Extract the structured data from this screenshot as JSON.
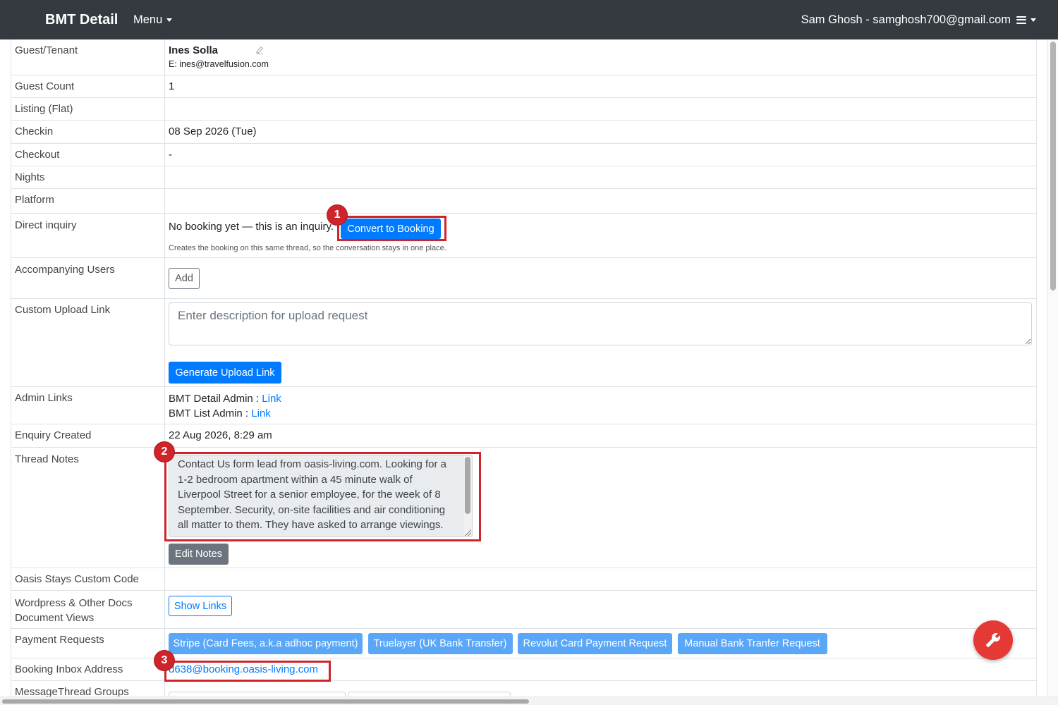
{
  "navbar": {
    "brand": "BMT Detail",
    "menu_label": "Menu",
    "user_label": "Sam Ghosh - samghosh700@gmail.com"
  },
  "rows": {
    "guest": {
      "label": "Guest/Tenant",
      "name": "Ines Solla",
      "email": "E: ines@travelfusion.com"
    },
    "guest_count": {
      "label": "Guest Count",
      "value": "1"
    },
    "listing": {
      "label": "Listing (Flat)"
    },
    "checkin": {
      "label": "Checkin",
      "value": "08 Sep 2026 (Tue)"
    },
    "checkout": {
      "label": "Checkout",
      "value": "-"
    },
    "nights": {
      "label": "Nights"
    },
    "platform": {
      "label": "Platform"
    },
    "direct_inquiry": {
      "label": "Direct inquiry",
      "status": "No booking yet — this is an inquiry.",
      "button": "Convert to Booking",
      "help": "Creates the booking on this same thread, so the conversation stays in one place."
    },
    "accompanying_users": {
      "label": "Accompanying Users",
      "button": "Add"
    },
    "custom_upload": {
      "label": "Custom Upload Link",
      "placeholder": "Enter description for upload request",
      "button": "Generate Upload Link"
    },
    "admin_links": {
      "label": "Admin Links",
      "detail_label": "BMT Detail Admin : ",
      "detail_link": "Link",
      "list_label": "BMT List Admin : ",
      "list_link": "Link"
    },
    "enquiry_created": {
      "label": "Enquiry Created",
      "value": "22 Aug 2026, 8:29 am"
    },
    "thread_notes": {
      "label": "Thread Notes",
      "value": "Contact Us form lead from oasis-living.com. Looking for a 1-2 bedroom apartment within a 45 minute walk of Liverpool Street for a senior employee, for the week of 8 September. Security, on-site facilities and air conditioning all matter to them. They have asked to arrange viewings.",
      "button": "Edit Notes"
    },
    "custom_code": {
      "label": "Oasis Stays Custom Code"
    },
    "docs": {
      "label": "Wordpress & Other Docs Document Views",
      "button": "Show Links"
    },
    "payments": {
      "label": "Payment Requests",
      "buttons": [
        "Stripe (Card Fees, a.k.a adhoc payment)",
        "Truelayer (UK Bank Transfer)",
        "Revolut Card Payment Request",
        "Manual Bank Tranfer Request"
      ]
    },
    "inbox": {
      "label": "Booking Inbox Address",
      "value": "d638@booking.oasis-living.com"
    },
    "groups": {
      "label": "MessageThread Groups"
    }
  },
  "annotations": [
    {
      "number": "1"
    },
    {
      "number": "2"
    },
    {
      "number": "3"
    }
  ],
  "icons": {
    "menu_caret": "caret-down-icon",
    "user_menu": "hamburger-icon",
    "edit_guest": "pencil-icon",
    "fab": "wrench-icon"
  },
  "colors": {
    "navbar": "#343a40",
    "primary": "#007bff",
    "primary_light": "#5aa7f8",
    "secondary": "#6c757d",
    "annotation": "#d0242b",
    "fab": "#e53935"
  }
}
